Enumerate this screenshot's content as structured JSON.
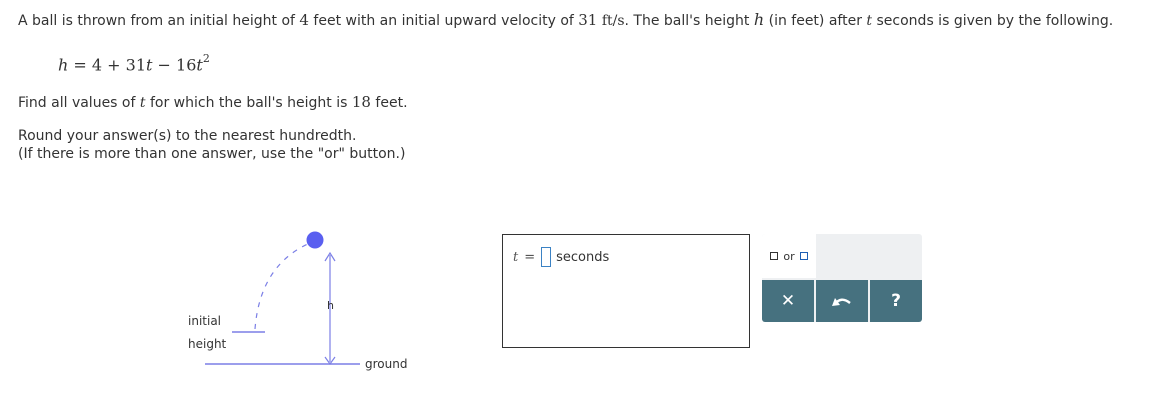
{
  "problem": {
    "intro_part1": "A ball is thrown from an initial height of ",
    "init_height": "4",
    "intro_part2": " feet with an initial upward velocity of ",
    "velocity": "31",
    "velocity_unit": "ft/s",
    "intro_part3": ". The ball's height ",
    "h_var": "h",
    "intro_part4": " (in feet) after ",
    "t_var": "t",
    "intro_part5": " seconds is given by the following.",
    "formula": {
      "h": "h",
      "eq": " = 4 + 31",
      "t1": "t",
      "minus": " − 16",
      "t2": "t",
      "exp": "2"
    },
    "find_part1": "Find all values of ",
    "find_t": "t",
    "find_part2": " for which the ball's height is ",
    "target_height": "18",
    "find_part3": " feet.",
    "round_text": "Round your answer(s) to the nearest hundredth.",
    "or_text": "(If there is more than one answer, use the \"or\" button.)"
  },
  "diagram": {
    "initial_label": "initial",
    "height_label": "height",
    "h_label": "h",
    "ground_label": "ground",
    "colors": {
      "line": "#7b7fe6",
      "ball": "#5a5ff0"
    }
  },
  "answer": {
    "t_label": "t",
    "equals": "=",
    "value": "",
    "unit": "seconds"
  },
  "keypad": {
    "or_label": "or",
    "clear_icon": "x-icon",
    "undo_icon": "undo-icon",
    "help_icon": "help-icon",
    "clear_symbol": "✕",
    "help_symbol": "?",
    "colors": {
      "button": "#46717f",
      "panel": "#eef0f2"
    }
  }
}
